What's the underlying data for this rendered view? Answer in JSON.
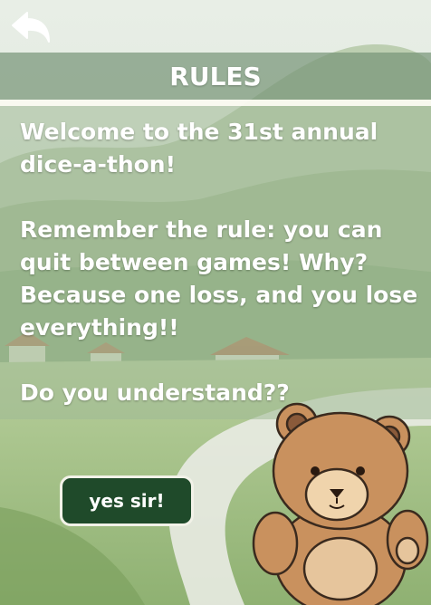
{
  "header": {
    "title": "RULES"
  },
  "rules": {
    "intro": "Welcome to the 31st annual dice-a-thon!",
    "rule": "Remember the rule: you can quit between games! Why? Because one loss, and you lose everything!!",
    "question": "Do you understand??"
  },
  "actions": {
    "confirm_label": "yes sir!"
  },
  "icons": {
    "back": "back-arrow-icon",
    "mascot": "teddy-bear"
  },
  "colors": {
    "button_bg": "#1f4a2a",
    "text": "#ffffff",
    "title_bar": "#7a967a"
  }
}
